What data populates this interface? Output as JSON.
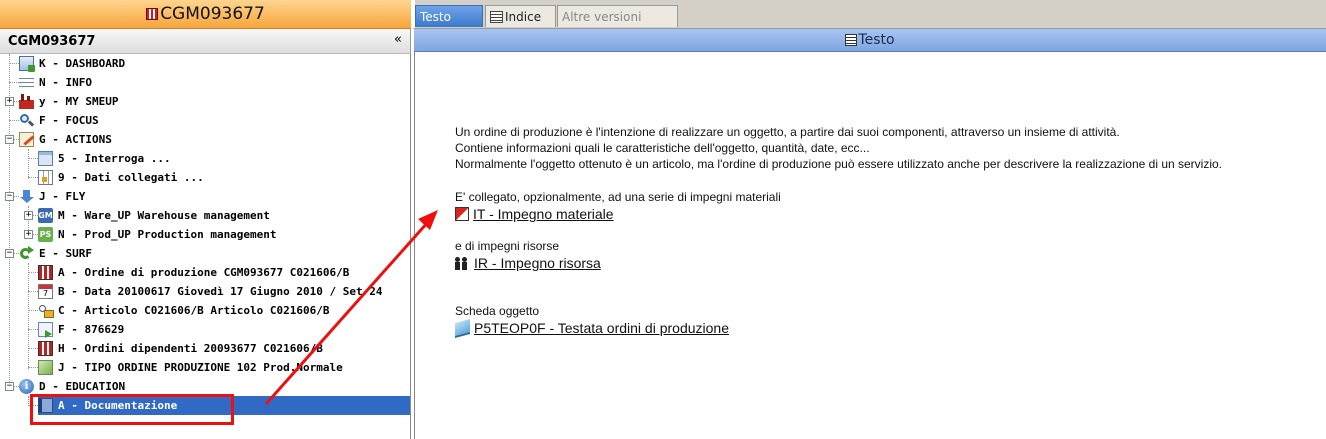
{
  "left_panel": {
    "window_title": "CGM093677",
    "header_title": "CGM093677",
    "collapse_glyph": "«",
    "tree": [
      {
        "label": "K - DASHBOARD",
        "icon": "dashboard-icon"
      },
      {
        "label": "N - INFO",
        "icon": "list-icon"
      },
      {
        "label": "y - MY SMEUP",
        "icon": "factory-icon"
      },
      {
        "label": "F - FOCUS",
        "icon": "magnifier-icon"
      },
      {
        "label": "G - ACTIONS",
        "icon": "notepad-icon"
      },
      {
        "label": "5 - Interroga ...",
        "icon": "window-icon"
      },
      {
        "label": "9 - Dati collegati ...",
        "icon": "grid-icon"
      },
      {
        "label": "J - FLY",
        "icon": "down-arrow-icon"
      },
      {
        "label": "M - Ware_UP Warehouse management",
        "icon": "gm-badge-icon",
        "badge": "GM"
      },
      {
        "label": "N - Prod_UP Production management",
        "icon": "ps-badge-icon",
        "badge": "PS"
      },
      {
        "label": "E - SURF",
        "icon": "refresh-arrow-icon"
      },
      {
        "label": "A - Ordine di produzione CGM093677 C021606/B",
        "icon": "order-icon"
      },
      {
        "label": "B - Data 20100617 Giovedì 17 Giugno 2010 / Set 24",
        "icon": "calendar-icon"
      },
      {
        "label": "C - Articolo C021606/B Articolo C021606/B",
        "icon": "article-icon"
      },
      {
        "label": "F - 876629",
        "icon": "forward-doc-icon"
      },
      {
        "label": "H - Ordini dipendenti 20093677 C021606/B",
        "icon": "order-icon"
      },
      {
        "label": "J - TIPO ORDINE PRODUZIONE 102 Prod.Normale",
        "icon": "type-icon"
      },
      {
        "label": "D - EDUCATION",
        "icon": "info-icon"
      },
      {
        "label": "A - Documentazione",
        "icon": "book-icon"
      }
    ]
  },
  "tabs": [
    {
      "label": "Testo",
      "state": "active"
    },
    {
      "label": "Indice",
      "state": "normal"
    },
    {
      "label": "Altre versioni",
      "state": "disabled"
    }
  ],
  "right_panel": {
    "header_title": "Testo",
    "paragraphs": [
      "Un ordine di produzione è l'intenzione di realizzare un oggetto, a partire dai suoi componenti, attraverso un insieme di attività.",
      "Contiene informazioni quali le caratteristiche dell'oggetto, quantità, date, ecc...",
      "Normalmente l'oggetto ottenuto è un articolo, ma l'ordine di produzione può essere utilizzato anche per descrivere la realizzazione di un servizio."
    ],
    "sections": [
      {
        "intro": "E' collegato, opzionalmente, ad una serie di impegni materiali",
        "link": "IT - Impegno materiale",
        "icon": "material-commitment-icon"
      },
      {
        "intro": "e di impegni risorse",
        "link": "IR - Impegno risorsa",
        "icon": "people-icon"
      },
      {
        "intro": "Scheda oggetto",
        "link": "P5TEOP0F - Testata ordini di produzione",
        "icon": "book-open-icon"
      }
    ]
  },
  "colors": {
    "selection": "#316ac5",
    "active_tab": "#3b78cc",
    "annotation": "#ee0f0f",
    "title_bar": "#f7a53c"
  }
}
